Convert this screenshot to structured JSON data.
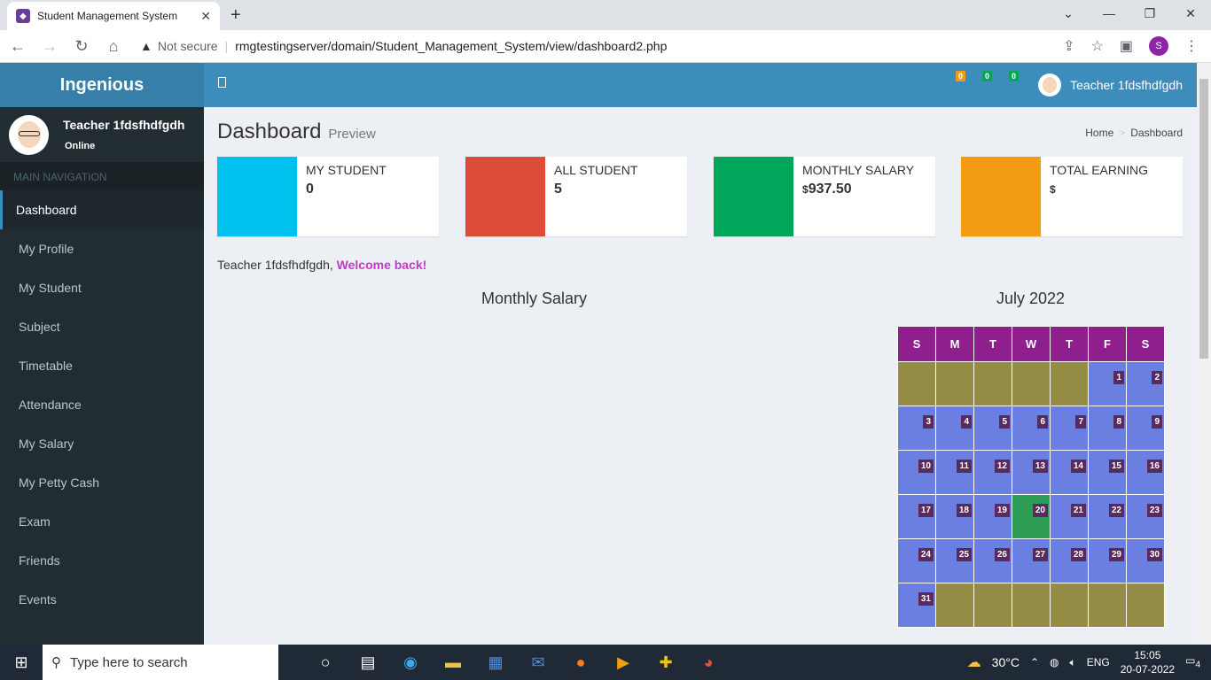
{
  "browser": {
    "tab_title": "Student Management System",
    "new_tab": "+",
    "not_secure": "Not secure",
    "url": "rmgtestingserver/domain/Student_Management_System/view/dashboard2.php",
    "profile_initial": "S"
  },
  "header": {
    "logo": "Ingenious",
    "badges": [
      "0",
      "0",
      "0"
    ],
    "user_name": "Teacher 1fdsfhdfgdh"
  },
  "sidebar": {
    "user_name": "Teacher 1fdsfhdfgdh",
    "status": "Online",
    "section_header": "MAIN NAVIGATION",
    "items": [
      {
        "label": "Dashboard"
      },
      {
        "label": "My Profile"
      },
      {
        "label": "My Student"
      },
      {
        "label": "Subject"
      },
      {
        "label": "Timetable"
      },
      {
        "label": "Attendance"
      },
      {
        "label": "My Salary"
      },
      {
        "label": "My Petty Cash"
      },
      {
        "label": "Exam"
      },
      {
        "label": "Friends"
      },
      {
        "label": "Events"
      }
    ]
  },
  "main": {
    "title": "Dashboard",
    "subtitle": "Preview",
    "breadcrumb": {
      "home": "Home",
      "current": "Dashboard"
    },
    "cards": [
      {
        "label": "MY STUDENT",
        "value": "0",
        "currency": "",
        "color": "#00c0ef"
      },
      {
        "label": "ALL STUDENT",
        "value": "5",
        "currency": "",
        "color": "#dd4b39"
      },
      {
        "label": "MONTHLY SALARY",
        "value": "937.50",
        "currency": "$",
        "color": "#00a65a"
      },
      {
        "label": "TOTAL EARNING",
        "value": "",
        "currency": "$",
        "color": "#f39c12"
      }
    ],
    "welcome_name": "Teacher 1fdsfhdfgdh,",
    "welcome_msg": "Welcome back!",
    "chart_title": "Monthly Salary",
    "calendar": {
      "title": "July 2022",
      "days": [
        "S",
        "M",
        "T",
        "W",
        "T",
        "F",
        "S"
      ],
      "first_weekday": 5,
      "num_days": 31,
      "today": 20
    }
  },
  "taskbar": {
    "search_placeholder": "Type here to search",
    "weather": "30°C",
    "lang": "ENG",
    "time": "15:05",
    "date": "20-07-2022",
    "notifications": "4"
  }
}
